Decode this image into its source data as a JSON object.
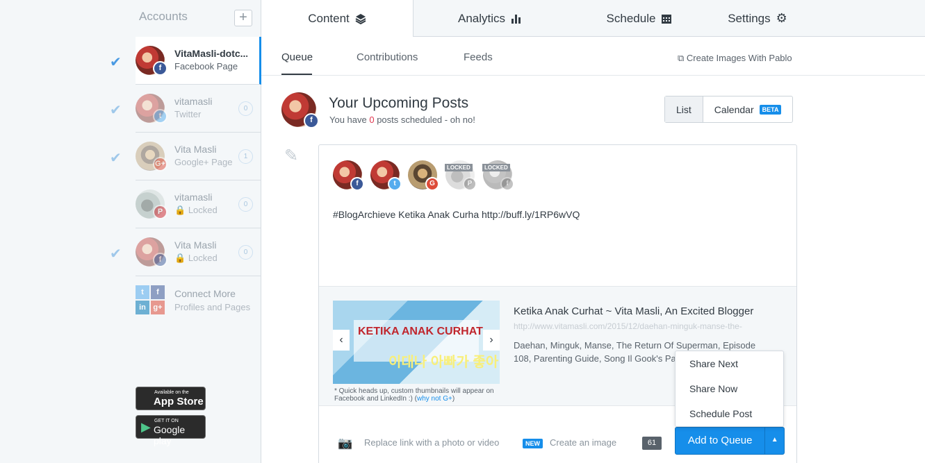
{
  "sidebar": {
    "header": "Accounts",
    "add_label": "+",
    "accounts": [
      {
        "name": "VitaMasli-dotc...",
        "sub": "Facebook Page",
        "network": "f",
        "count": ""
      },
      {
        "name": "vitamasli",
        "sub": "Twitter",
        "network": "t",
        "count": "0"
      },
      {
        "name": "Vita Masli",
        "sub": "Google+ Page",
        "network": "G+",
        "count": "1"
      },
      {
        "name": "vitamasli",
        "sub": "Locked",
        "network": "P",
        "count": "0"
      },
      {
        "name": "Vita Masli",
        "sub": "Locked",
        "network": "f",
        "count": "0"
      }
    ],
    "connect": {
      "title": "Connect More",
      "sub": "Profiles and Pages"
    },
    "app_store": {
      "small": "Available on the",
      "big": "App Store"
    },
    "google_play": {
      "small": "GET IT ON",
      "big": "Google play"
    }
  },
  "tabs": {
    "content": "Content",
    "analytics": "Analytics",
    "schedule": "Schedule",
    "settings": "Settings"
  },
  "subtabs": {
    "queue": "Queue",
    "contributions": "Contributions",
    "feeds": "Feeds",
    "pablo": "Create Images With Pablo"
  },
  "header": {
    "title": "Your Upcoming Posts",
    "sub_prefix": "You have ",
    "count": "0",
    "sub_suffix": " posts scheduled - oh no!",
    "list_label": "List",
    "calendar_label": "Calendar",
    "beta_label": "BETA"
  },
  "composer": {
    "locked_label": "LOCKED",
    "text": "#BlogArchieve Ketika Anak Curha http://buff.ly/1RP6wVQ",
    "thumb_title": "KETIKA ANAK CURHAT",
    "thumb_sub": "이대나 아빠가 좋아",
    "note": "* Quick heads up, custom thumbnails will appear on Facebook and LinkedIn :) (",
    "note_link": "why not G+",
    "note_end": ")",
    "link_title": "Ketika Anak Curhat ~ Vita Masli, An Excited Blogger",
    "link_url": "http://www.vitamasli.com/2015/12/daehan-minguk-manse-the-",
    "link_desc": "Daehan, Minguk, Manse, The Return Of Superman, Episode 108, Parenting Guide, Song Il Gook's Parenting",
    "replace_label": "Replace link with a photo or video",
    "new_label": "NEW",
    "create_image": "Create an image",
    "char_count": "61",
    "queue_button": "Add to Queue"
  },
  "dropdown": [
    "Share Next",
    "Share Now",
    "Schedule Post"
  ],
  "colors": {
    "accent": "#168eea",
    "facebook": "#3b5998",
    "twitter": "#55acee",
    "google": "#dd4b39",
    "pinterest": "#cb2027",
    "alert": "#e0364f"
  }
}
